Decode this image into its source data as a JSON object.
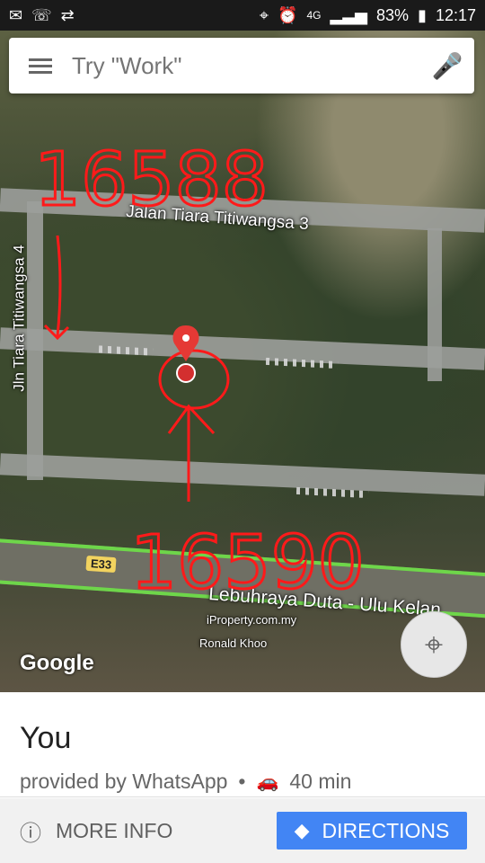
{
  "status": {
    "left_icons": [
      "mail-icon",
      "missed-call-icon",
      "sync-icon"
    ],
    "right_icons": [
      "location-icon",
      "alarm-icon",
      "signal-icon"
    ],
    "network": "4G",
    "battery": "83%",
    "time": "12:17"
  },
  "search": {
    "placeholder": "Try \"Work\""
  },
  "map": {
    "road_labels": [
      "Jalan Tiara Titiwangsa 3",
      "Jln Tiara Titiwangsa 4",
      "Lebuhraya Duta - Ulu Kelan"
    ],
    "highway_shield": "E33",
    "watermark": "iProperty.com.my",
    "credit": "Ronald Khoo",
    "google_logo": "Google",
    "handwritten_numbers": [
      "16588",
      "16590"
    ]
  },
  "sheet": {
    "title": "You",
    "subtitle": "provided by WhatsApp",
    "separator": "•",
    "travel_time": "40 min",
    "more_info": "MORE INFO",
    "directions": "DIRECTIONS"
  }
}
